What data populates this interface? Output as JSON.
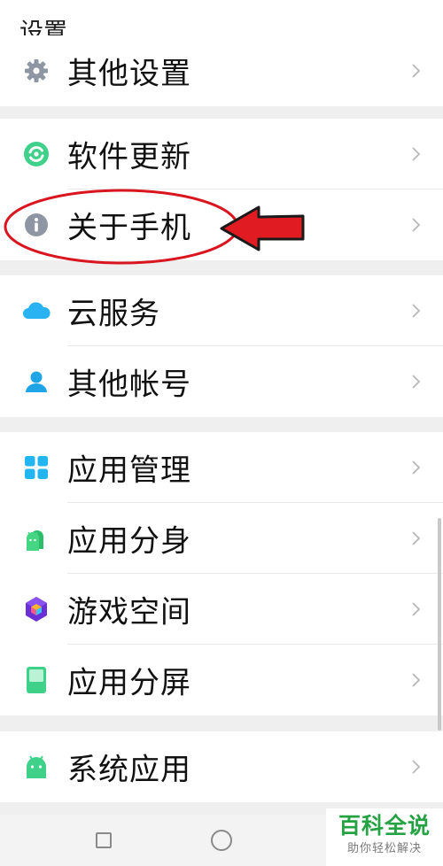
{
  "header": {
    "title": "设置"
  },
  "groups": [
    {
      "items": [
        {
          "label": "其他设置",
          "icon": "gear-icon"
        }
      ]
    },
    {
      "items": [
        {
          "label": "软件更新",
          "icon": "update-icon"
        },
        {
          "label": "关于手机",
          "icon": "info-icon"
        }
      ]
    },
    {
      "items": [
        {
          "label": "云服务",
          "icon": "cloud-icon"
        },
        {
          "label": "其他帐号",
          "icon": "user-icon"
        }
      ]
    },
    {
      "items": [
        {
          "label": "应用管理",
          "icon": "app-grid-icon"
        },
        {
          "label": "应用分身",
          "icon": "app-clone-icon"
        },
        {
          "label": "游戏空间",
          "icon": "game-cube-icon"
        },
        {
          "label": "应用分屏",
          "icon": "split-screen-icon"
        }
      ]
    },
    {
      "items": [
        {
          "label": "系统应用",
          "icon": "android-icon"
        }
      ]
    }
  ],
  "watermark": {
    "main": "百科全说",
    "sub": "助你轻松解决"
  },
  "colors": {
    "accent_green": "#3fd18a",
    "accent_blue": "#2ab3f2",
    "annotation_red": "#d9161f",
    "watermark_green": "#25a244"
  }
}
